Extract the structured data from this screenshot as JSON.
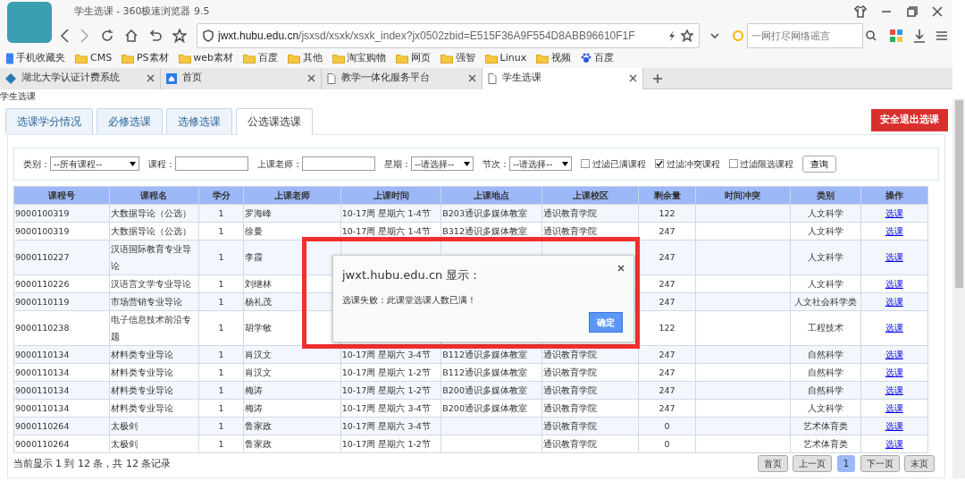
{
  "browser": {
    "title": "学生选课 - 360极速浏览器 9.5",
    "address": {
      "host": "jwxt.hubu.edu.cn",
      "path": "/jsxsd/xsxk/xsxk_index?jx0502zbid=E515F36A9F554D8ABB96610F1F"
    },
    "search": {
      "placeholder": "一网打尽网络谣言"
    },
    "bookmarks": [
      {
        "kind": "device",
        "label": "手机收藏夹"
      },
      {
        "kind": "folder",
        "label": "CMS"
      },
      {
        "kind": "folder",
        "label": "PS素材"
      },
      {
        "kind": "folder",
        "label": "web素材"
      },
      {
        "kind": "folder",
        "label": "百度"
      },
      {
        "kind": "folder",
        "label": "其他"
      },
      {
        "kind": "folder",
        "label": "淘宝购物"
      },
      {
        "kind": "folder",
        "label": "网页"
      },
      {
        "kind": "folder",
        "label": "强智"
      },
      {
        "kind": "folder",
        "label": "Linux"
      },
      {
        "kind": "folder",
        "label": "视频"
      },
      {
        "kind": "paw",
        "label": "百度"
      }
    ],
    "tabs": [
      {
        "kind": "diamond",
        "label": "湖北大学认证计费系统",
        "selected": false
      },
      {
        "kind": "home",
        "label": "首页",
        "selected": false
      },
      {
        "kind": "page",
        "label": "教学一体化服务平台",
        "selected": false
      },
      {
        "kind": "page",
        "label": "学生选课",
        "selected": true
      }
    ]
  },
  "page": {
    "heading": "学生选课",
    "tabs": [
      {
        "label": "选课学分情况",
        "selected": false
      },
      {
        "label": "必修选课",
        "selected": false
      },
      {
        "label": "选修选课",
        "selected": false
      },
      {
        "label": "公选课选课",
        "selected": true
      }
    ],
    "logout_button": "安全退出选课",
    "filters": {
      "category": {
        "label": "类别：",
        "value": "--所有课程--"
      },
      "course": {
        "label": "课程："
      },
      "teacher": {
        "label": "上课老师："
      },
      "weekday": {
        "label": "星期：",
        "value": "--请选择--"
      },
      "period": {
        "label": "节次：",
        "value": "--请选择--"
      },
      "checkboxes": [
        {
          "label": "过滤已满课程",
          "checked": false
        },
        {
          "label": "过滤冲突课程",
          "checked": true
        },
        {
          "label": "过滤限选课程",
          "checked": false
        }
      ],
      "query_button": "查询"
    },
    "table": {
      "columns": [
        "课程号",
        "课程名",
        "学分",
        "上课老师",
        "上课时间",
        "上课地点",
        "上课校区",
        "剩余量",
        "时间冲突",
        "类别",
        "操作"
      ],
      "rows": [
        {
          "code": "9000100319",
          "name": "大数据导论（公选）",
          "credit": "1",
          "teacher": "罗海峰",
          "time": "10-17周 星期六 1-4节",
          "place": "B203通识多媒体教室",
          "campus": "通识教育学院",
          "remaining": "122",
          "category": "人文科学",
          "action": "选课"
        },
        {
          "code": "9000100319",
          "name": "大数据导论（公选）",
          "credit": "1",
          "teacher": "徐曼",
          "time": "10-17周 星期六 1-4节",
          "place": "B312通识多媒体教室",
          "campus": "通识教育学院",
          "remaining": "247",
          "category": "人文科学",
          "action": "选课"
        },
        {
          "code": "9000110227",
          "name": "汉语国际教育专业导论",
          "credit": "1",
          "teacher": "李霞",
          "remaining": "247",
          "category": "人文科学",
          "action": "选课"
        },
        {
          "code": "9000110226",
          "name": "汉语言文学专业导论",
          "credit": "1",
          "teacher": "刘继林",
          "remaining": "247",
          "category": "人文科学",
          "action": "选课"
        },
        {
          "code": "9000110119",
          "name": "市场营销专业导论",
          "credit": "1",
          "teacher": "杨礼茂",
          "remaining": "247",
          "category": "人文社会科学类",
          "action": "选课"
        },
        {
          "code": "9000110238",
          "name": "电子信息技术前沿专题",
          "credit": "1",
          "teacher": "胡学敏",
          "remaining": "122",
          "category": "工程技术",
          "action": "选课"
        },
        {
          "code": "9000110134",
          "name": "材料类专业导论",
          "credit": "1",
          "teacher": "肖汉文",
          "time": "10-17周 星期六 3-4节",
          "place": "B112通识多媒体教室",
          "campus": "通识教育学院",
          "remaining": "247",
          "category": "自然科学",
          "action": "选课"
        },
        {
          "code": "9000110134",
          "name": "材料类专业导论",
          "credit": "1",
          "teacher": "肖汉文",
          "time": "10-17周 星期六 1-2节",
          "place": "B112通识多媒体教室",
          "campus": "通识教育学院",
          "remaining": "247",
          "category": "自然科学",
          "action": "选课"
        },
        {
          "code": "9000110134",
          "name": "材料类专业导论",
          "credit": "1",
          "teacher": "梅涛",
          "time": "10-17周 星期六 1-2节",
          "place": "B200通识多媒体教室",
          "campus": "通识教育学院",
          "remaining": "247",
          "category": "自然科学",
          "action": "选课"
        },
        {
          "code": "9000110134",
          "name": "材料类专业导论",
          "credit": "1",
          "teacher": "梅涛",
          "time": "10-17周 星期六 3-4节",
          "place": "B200通识多媒体教室",
          "campus": "通识教育学院",
          "remaining": "247",
          "category": "人文科学",
          "action": "选课"
        },
        {
          "code": "9000110264",
          "name": "太极剑",
          "credit": "1",
          "teacher": "鲁家政",
          "time": "10-17周 星期六 3-4节",
          "campus": "通识教育学院",
          "remaining": "0",
          "category": "艺术体育类",
          "action": "选课"
        },
        {
          "code": "9000110264",
          "name": "太极剑",
          "credit": "1",
          "teacher": "鲁家政",
          "time": "10-17周 星期六 1-2节",
          "campus": "通识教育学院",
          "remaining": "0",
          "category": "艺术体育类",
          "action": "选课"
        }
      ]
    },
    "footer": "当前显示 1 到 12 条，共 12 条记录",
    "pagination": [
      {
        "label": "首页",
        "selected": false
      },
      {
        "label": "上一页",
        "selected": false
      },
      {
        "label": "1",
        "selected": true
      },
      {
        "label": "下一页",
        "selected": false
      },
      {
        "label": "末页",
        "selected": false
      }
    ],
    "dialog": {
      "title": "jwxt.hubu.edu.cn 显示：",
      "message": "选课失败：此课堂选课人数已满！",
      "button": "确定"
    }
  }
}
